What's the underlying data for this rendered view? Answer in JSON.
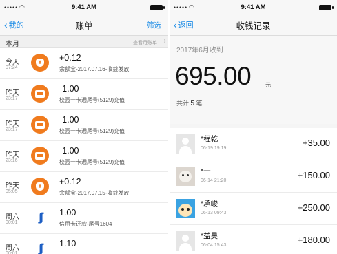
{
  "status_bar": {
    "time": "9:41 AM"
  },
  "left": {
    "nav": {
      "back_label": "我的",
      "title": "账单",
      "action_label": "筛选"
    },
    "section": {
      "month": "本月",
      "link_label": "查看月账单"
    },
    "rows": [
      {
        "day": "今天",
        "time": "07:24",
        "icon": "yuebao-icon",
        "amount": "+0.12",
        "description": "余额宝-2017.07.16-收益发放"
      },
      {
        "day": "昨天",
        "time": "23:17",
        "icon": "campus-card-icon",
        "amount": "-1.00",
        "description": "校园一卡通尾号(5129)充值"
      },
      {
        "day": "昨天",
        "time": "23:17",
        "icon": "campus-card-icon",
        "amount": "-1.00",
        "description": "校园一卡通尾号(5129)充值"
      },
      {
        "day": "昨天",
        "time": "23:16",
        "icon": "campus-card-icon",
        "amount": "-1.00",
        "description": "校园一卡通尾号(5129)充值"
      },
      {
        "day": "昨天",
        "time": "05:05",
        "icon": "yuebao-icon",
        "amount": "+0.12",
        "description": "余额宝-2017.07.15-收益发放"
      },
      {
        "day": "周六",
        "time": "00:01",
        "icon": "bank-logo-icon",
        "amount": "1.00",
        "description": "信用卡还款-尾号1604"
      },
      {
        "day": "周六",
        "time": "00:01",
        "icon": "bank-logo-icon",
        "amount": "1.10",
        "description": ""
      }
    ]
  },
  "right": {
    "nav": {
      "back_label": "返回",
      "title": "收钱记录"
    },
    "summary": {
      "period": "2017年6月收到",
      "total": "695.00",
      "unit": "元",
      "count_prefix": "共计",
      "count": "5",
      "count_suffix": "笔"
    },
    "records": [
      {
        "name": "*程乾",
        "time": "06-19 19:19",
        "amount": "+35.00",
        "avatar": "default-avatar-icon"
      },
      {
        "name": "*一",
        "time": "06-14 21:20",
        "amount": "+150.00",
        "avatar": "dog-photo-avatar"
      },
      {
        "name": "*承峻",
        "time": "06-13 09:43",
        "amount": "+250.00",
        "avatar": "cartoon-avatar"
      },
      {
        "name": "*益昊",
        "time": "06-04 15:43",
        "amount": "+180.00",
        "avatar": "default-avatar-icon"
      }
    ]
  },
  "colors": {
    "accent": "#1a8be6",
    "orange_icon": "#f07b1e",
    "bank_blue": "#1d5fc4"
  }
}
